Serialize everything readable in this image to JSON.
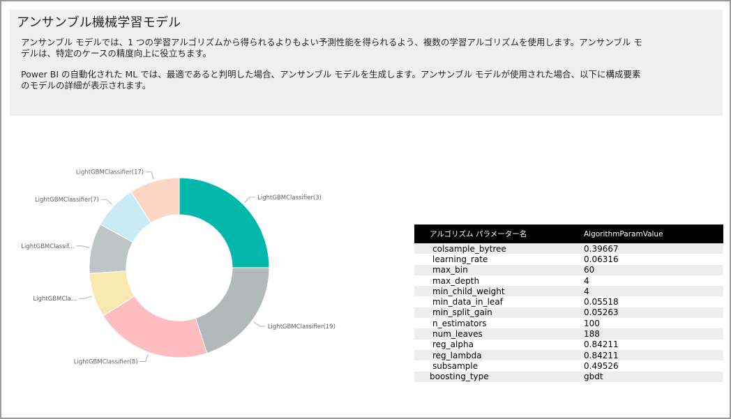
{
  "page": {
    "title": "アンサンブル機械学習モデル",
    "description_1": "アンサンブル モデルでは、1 つの学習アルゴリズムから得られるよりもよい予測性能を得られるよう、複数の学習アルゴリズムを使用します。アンサンブル モデルは、特定のケースの精度向上に役立ちます。",
    "description_2": "Power BI の自動化された ML では、最適であると判明した場合、アンサンブル モデルを生成します。アンサンブル モデルが使用された場合、以下に構成要素のモデルの詳細が表示されます。"
  },
  "chart_data": {
    "type": "pie",
    "donut": true,
    "labels": [
      "LightGBMClassifier(3)",
      "LightGBMClassifier(19)",
      "LightGBMClassifier(8)",
      "LightGBMCla...",
      "LightGBMClassif...",
      "LightGBMClassifier(7)",
      "LightGBMClassifier(17)"
    ],
    "values": [
      0.25,
      0.2,
      0.21,
      0.08,
      0.09,
      0.08,
      0.09
    ],
    "colors": [
      "#01b8aa",
      "#b3b8b8",
      "#fdbdc1",
      "#f8e9b0",
      "#bfc4c4",
      "#c9ebf3",
      "#fdd6c8"
    ]
  },
  "table": {
    "headers": [
      "アルゴリズム パラメーター名",
      "AlgorithmParamValue"
    ],
    "rows": [
      [
        "colsample_bytree",
        "0.39667"
      ],
      [
        "learning_rate",
        "0.06316"
      ],
      [
        "max_bin",
        "60"
      ],
      [
        "max_depth",
        "4"
      ],
      [
        "min_child_weight",
        "4"
      ],
      [
        "min_data_in_leaf",
        "0.05518"
      ],
      [
        "min_split_gain",
        "0.05263"
      ],
      [
        "n_estimators",
        "100"
      ],
      [
        "num_leaves",
        "188"
      ],
      [
        "reg_alpha",
        "0.84211"
      ],
      [
        "reg_lambda",
        "0.84211"
      ],
      [
        "subsample",
        "0.49526"
      ],
      [
        "boosting_type",
        "gbdt"
      ]
    ]
  }
}
